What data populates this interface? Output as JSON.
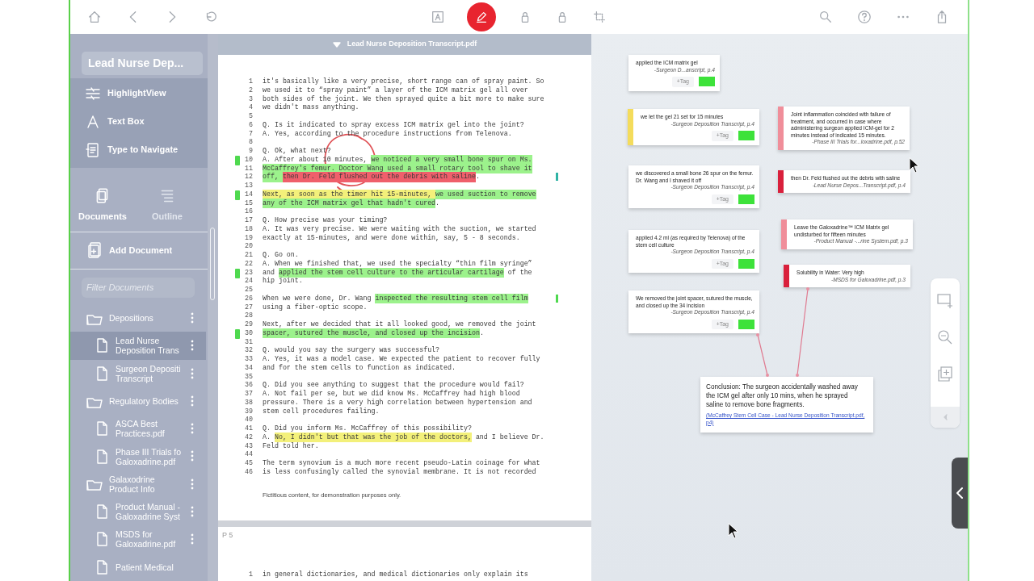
{
  "toolbar": {
    "tools": [
      {
        "selected": false
      },
      {
        "selected": true
      },
      {
        "selected": false
      },
      {
        "selected": false
      },
      {
        "selected": false
      }
    ]
  },
  "sidebar": {
    "title": "Lead Nurse Dep...",
    "actions": [
      "HighlightView",
      "Text Box",
      "Type to Navigate"
    ],
    "tabs": [
      {
        "label": "Documents",
        "selected": true
      },
      {
        "label": "Outline",
        "selected": false
      }
    ],
    "add_document": "Add Document",
    "filter": {
      "placeholder": "Filter Documents"
    },
    "tree": [
      {
        "kind": "folder",
        "label": "Depositions",
        "selected": false,
        "children": [
          {
            "kind": "file",
            "label": "Lead Nurse\nDeposition Trans",
            "selected": true
          },
          {
            "kind": "file",
            "label": "Surgeon Depositi\nTranscript",
            "selected": false
          }
        ]
      },
      {
        "kind": "folder",
        "label": "Regulatory Bodies",
        "selected": false,
        "children": [
          {
            "kind": "file",
            "label": "ASCA Best\nPractices.pdf",
            "selected": false
          },
          {
            "kind": "file",
            "label": "Phase III Trials fo\nGaloxadrine.pdf",
            "selected": false
          }
        ]
      },
      {
        "kind": "folder",
        "label": "Galaxodrine\nProduct Info",
        "selected": false,
        "children": [
          {
            "kind": "file",
            "label": "Product Manual -\nGaloxadrine Syst",
            "selected": false
          },
          {
            "kind": "file",
            "label": "MSDS for\nGaloxadrine.pdf",
            "selected": false
          }
        ]
      },
      {
        "kind": "file",
        "label": "Patient Medical",
        "selected": false
      }
    ]
  },
  "document": {
    "title": "Lead Nurse Deposition Transcript.pdf",
    "pages": [
      {
        "lines": [
          {
            "n": "1",
            "segments": [
              {
                "text": "it's basically like a very precise, short range can of spray paint. So"
              }
            ]
          },
          {
            "n": "2",
            "segments": [
              {
                "text": "we used it to “spray paint” a layer of the ICM matrix gel all over"
              }
            ]
          },
          {
            "n": "3",
            "segments": [
              {
                "text": "both sides of the joint. We then sprayed quite a bit more to make sure"
              }
            ]
          },
          {
            "n": "4",
            "segments": [
              {
                "text": "we didn't mass anything."
              }
            ]
          },
          {
            "n": "5"
          },
          {
            "n": "6",
            "segments": [
              {
                "text": "Q. Is it indicated to spray excess ICM matrix gel into the joint?"
              }
            ]
          },
          {
            "n": "7",
            "segments": [
              {
                "text": "A. Yes, according to the procedure instructions from Telenova."
              }
            ]
          },
          {
            "n": "8"
          },
          {
            "n": "9",
            "segments": [
              {
                "text": "Q. Ok, what next?"
              }
            ]
          },
          {
            "n": "10",
            "margin_mark": {
              "color": "#4fd94f"
            },
            "segments": [
              {
                "text": "A. After about 10 minutes, "
              },
              {
                "text": "we noticed a very small bone spur on Ms.",
                "color": "#9cf28c"
              }
            ]
          },
          {
            "n": "11",
            "segments": [
              {
                "text": "McCaffrey's femur. Doctor Wang used a small rotary tool to shave it",
                "color": "#9cf28c"
              }
            ]
          },
          {
            "n": "12",
            "side_mark": {
              "color": "#2fb3a5"
            },
            "segments": [
              {
                "text": "off, ",
                "color": "#9cf28c"
              },
              {
                "text": "then Dr. Feld flushed out the debris with saline",
                "color": "#ef5f6b"
              },
              {
                "text": "."
              }
            ]
          },
          {
            "n": "13"
          },
          {
            "n": "14",
            "margin_mark": {
              "color": "#4fd94f"
            },
            "segments": [
              {
                "text": "Next, as soon as the timer hit 15-minutes, ",
                "color": "#f3f07a"
              },
              {
                "text": "we used suction to remove",
                "color": "#9cf28c"
              }
            ]
          },
          {
            "n": "15",
            "segments": [
              {
                "text": "any of the ICM matrix gel that hadn't cured",
                "color": "#9cf28c"
              },
              {
                "text": "."
              }
            ]
          },
          {
            "n": "16"
          },
          {
            "n": "17",
            "segments": [
              {
                "text": "Q. How precise was your timing?"
              }
            ]
          },
          {
            "n": "18",
            "segments": [
              {
                "text": "A. It was very precise. We were waiting with the suction, we started"
              }
            ]
          },
          {
            "n": "19",
            "segments": [
              {
                "text": "exactly at 15-minutes, and were done within, say, 5 - 8 seconds."
              }
            ]
          },
          {
            "n": "20"
          },
          {
            "n": "21",
            "segments": [
              {
                "text": "Q. Go on."
              }
            ]
          },
          {
            "n": "22",
            "segments": [
              {
                "text": "A. When we finished that, we used the specialty “thin film syringe”"
              }
            ]
          },
          {
            "n": "23",
            "margin_mark": {
              "color": "#4fd94f"
            },
            "segments": [
              {
                "text": "and "
              },
              {
                "text": "applied the stem cell culture to the articular cartilage",
                "color": "#9cf28c"
              },
              {
                "text": " of the"
              }
            ]
          },
          {
            "n": "24",
            "segments": [
              {
                "text": "hip joint."
              }
            ]
          },
          {
            "n": "25"
          },
          {
            "n": "26",
            "side_mark": {
              "color": "#4fd94f"
            },
            "segments": [
              {
                "text": "When we were done, Dr. Wang "
              },
              {
                "text": "inspected the resulting stem cell film",
                "color": "#9cf28c"
              }
            ]
          },
          {
            "n": "27",
            "segments": [
              {
                "text": "using a fiber-optic scope."
              }
            ]
          },
          {
            "n": "28"
          },
          {
            "n": "29",
            "segments": [
              {
                "text": "Next, after we decided that it all looked good, we removed the joint"
              }
            ]
          },
          {
            "n": "30",
            "margin_mark": {
              "color": "#4fd94f"
            },
            "segments": [
              {
                "text": "spacer, sutured the muscle, and closed up the incision",
                "color": "#9cf28c"
              },
              {
                "text": "."
              }
            ]
          },
          {
            "n": "31"
          },
          {
            "n": "32",
            "segments": [
              {
                "text": "Q. would you say the surgery was successful?"
              }
            ]
          },
          {
            "n": "33",
            "segments": [
              {
                "text": "A. Yes, it was a model case. We expected the patient to recover fully"
              }
            ]
          },
          {
            "n": "34",
            "segments": [
              {
                "text": "and for the stem cells to function as indicated."
              }
            ]
          },
          {
            "n": "35"
          },
          {
            "n": "36",
            "segments": [
              {
                "text": "Q. Did you see anything to suggest that the procedure would fail?"
              }
            ]
          },
          {
            "n": "37",
            "segments": [
              {
                "text": "A. Not fail per se, but we did know Ms. McCaffrey had high blood"
              }
            ]
          },
          {
            "n": "38",
            "segments": [
              {
                "text": "pressure. There is a very high correlation between hypertension and"
              }
            ]
          },
          {
            "n": "39",
            "segments": [
              {
                "text": "stem cell procedures failing."
              }
            ]
          },
          {
            "n": "40"
          },
          {
            "n": "41",
            "segments": [
              {
                "text": "Q. Did you inform Ms. McCaffrey of this possibility?"
              }
            ]
          },
          {
            "n": "42",
            "segments": [
              {
                "text": "A. "
              },
              {
                "text": "No, I didn't but that was the job of the doctors,",
                "color": "#f3f07a"
              },
              {
                "text": " and I believe Dr."
              }
            ]
          },
          {
            "n": "43",
            "segments": [
              {
                "text": "Feld told her."
              }
            ]
          },
          {
            "n": "44"
          },
          {
            "n": "45",
            "segments": [
              {
                "text": "The term synovium is a much more recent pseudo-Latin coinage for what"
              }
            ]
          },
          {
            "n": "46",
            "segments": [
              {
                "text": "is less confusingly called the synovial membrane. It is not recorded"
              }
            ]
          }
        ],
        "footer": "Fictitious content, for demonstration purposes only."
      },
      {
        "label": "P 5",
        "lines": [
          {
            "n": "1",
            "segments": [
              {
                "text": "in general dictionaries, and medical dictionaries only explain its"
              }
            ]
          }
        ]
      }
    ]
  },
  "canvas": {
    "cards": [
      {
        "kind": "tagged",
        "text": "applied the ICM matrix gel",
        "source": "-Surgeon D...anscript, p.4",
        "tag": "+Tag"
      },
      {
        "kind": "tagged",
        "color": "#f4dc5c",
        "text": "we let the gel  21 set for 15 minutes",
        "source": "-Surgeon Deposition Transcript, p.4",
        "tag": "+Tag"
      },
      {
        "kind": "tagged",
        "text": "we discovered a small bone  26 spur on the femur. Dr. Wang and I shaved it off",
        "source": "-Surgeon Deposition Transcript, p.4",
        "tag": "+Tag"
      },
      {
        "kind": "tagged",
        "text": "applied 4.2 ml (as required by Telenova) of the stem cell culture",
        "source": "-Surgeon Deposition Transcript, p.4",
        "tag": "+Tag"
      },
      {
        "kind": "tagged",
        "linked": true,
        "text": "We removed the joint spacer, sutured the muscle, and closed up the  34 incision",
        "source": "-Surgeon Deposition Transcript, p.4",
        "tag": "+Tag"
      },
      {
        "kind": "plain",
        "color": "#f08e9a",
        "text": "Joint inflammation coincided with failure of treatment, and occurred in case where administering surgeon applied ICM-gel for 2 minutes  instead of indicated 15 minutes.",
        "source": "-Phase III Trials for...loxadrine.pdf, p.52"
      },
      {
        "kind": "plain",
        "color": "#d9203c",
        "text": "then Dr. Feld flushed out the debris with saline",
        "source": "-Lead Nurse Depos...Transcript.pdf, p.4"
      },
      {
        "kind": "plain",
        "color": "#f08e9a",
        "text": "Leave the Galoxadrine™ ICM Matrix gel undisturbed for fifteen minutes",
        "source": "-Product Manual -...rine System.pdf, p.3"
      },
      {
        "kind": "plain",
        "color": "#d9203c",
        "linked": true,
        "text": "Solubility in Water: Very high",
        "source": "-MSDS for Galoxadrine.pdf, p.3"
      }
    ],
    "conclusion": {
      "text": "Conclusion: The surgeon accidentally washed away the ICM gel after only 10 mins, when he sprayed saline to remove bone fragments.",
      "link": "(McCaffrey Stem Cell Case - Lead Nurse Deposition Transcript.pdf, p4)"
    }
  }
}
